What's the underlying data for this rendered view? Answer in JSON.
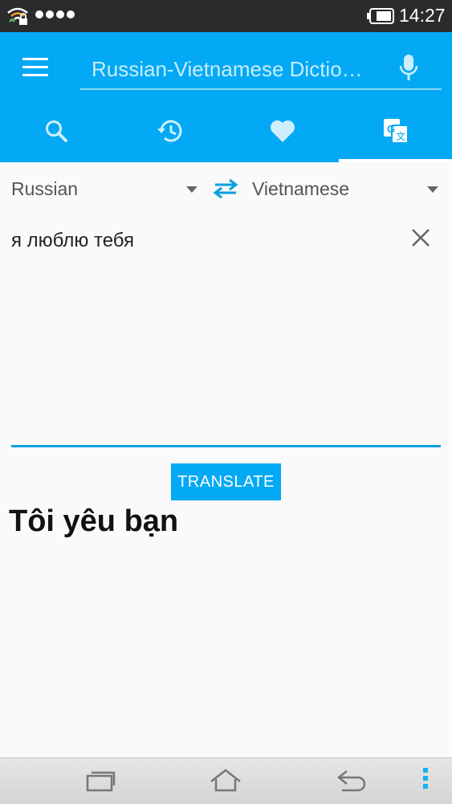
{
  "status_bar": {
    "time": "14:27"
  },
  "app_bar": {
    "search": {
      "placeholder": "Russian-Vietnamese Dictio…",
      "value": ""
    },
    "tabs": [
      {
        "id": "search",
        "icon": "search-icon",
        "active": false
      },
      {
        "id": "history",
        "icon": "history-icon",
        "active": false
      },
      {
        "id": "favorites",
        "icon": "heart-icon",
        "active": false
      },
      {
        "id": "translate",
        "icon": "translate-icon",
        "active": true
      }
    ]
  },
  "translator": {
    "source_lang": "Russian",
    "target_lang": "Vietnamese",
    "input_text": "я люблю тебя",
    "translate_label": "TRANSLATE",
    "result_text": "Tôi yêu bạn"
  },
  "colors": {
    "accent": "#03a9f4",
    "status_bar": "#2b2b2b",
    "background": "#fafafa"
  }
}
